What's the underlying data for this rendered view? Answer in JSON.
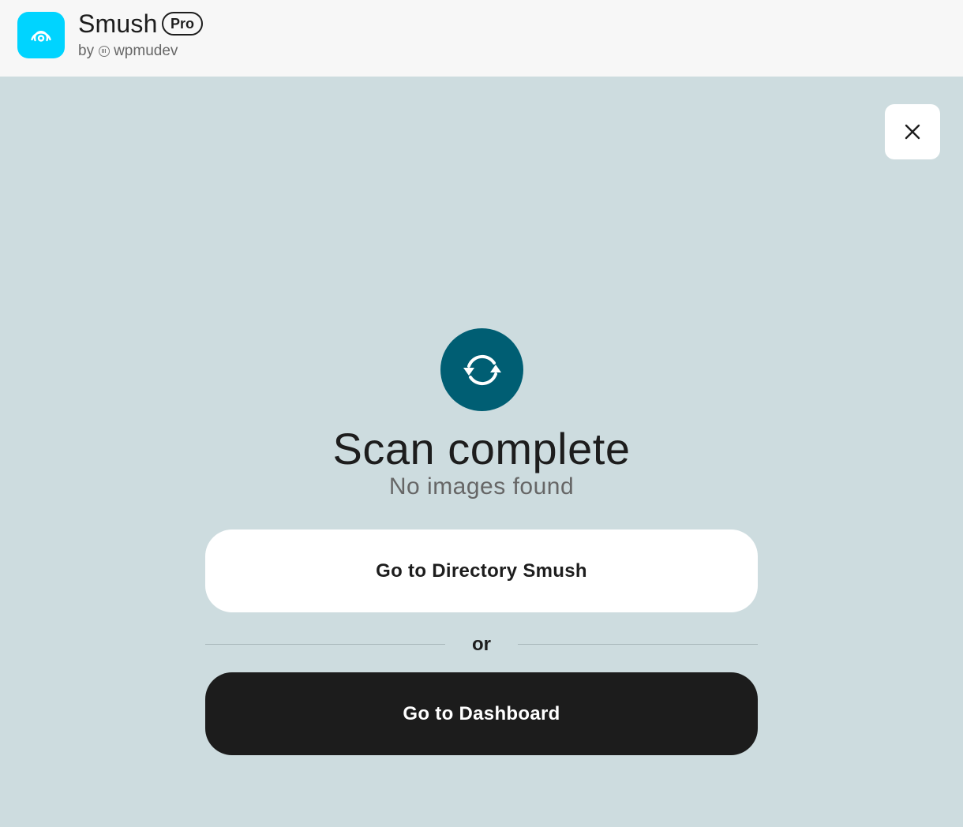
{
  "header": {
    "app_name": "Smush",
    "badge": "Pro",
    "by_prefix": "by",
    "vendor": "wpmudev",
    "app_icon": "smush-logo-icon",
    "vendor_icon": "wpmudev-logo-icon",
    "accent_color": "#00d4ff"
  },
  "dialog": {
    "close_icon": "close-icon",
    "status_icon": "sync-icon",
    "status_icon_color": "#005e73",
    "title": "Scan complete",
    "subtitle": "No images found",
    "primary_action_label": "Go to Directory Smush",
    "separator_label": "or",
    "secondary_action_label": "Go to Dashboard"
  }
}
